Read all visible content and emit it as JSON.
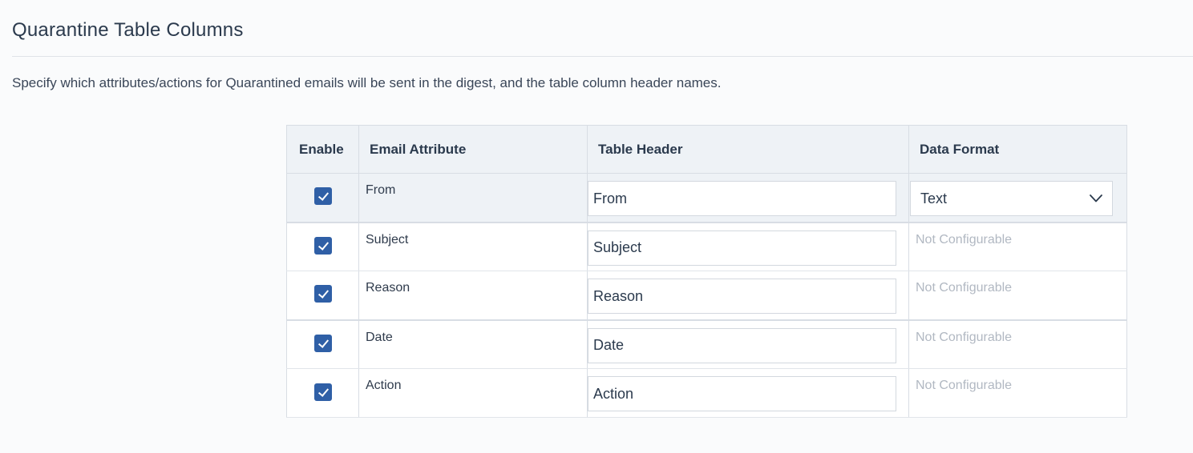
{
  "section": {
    "title": "Quarantine Table Columns",
    "description": "Specify which attributes/actions for Quarantined emails will be sent in the digest, and the table column header names."
  },
  "table": {
    "headers": {
      "enable": "Enable",
      "attribute": "Email Attribute",
      "header": "Table Header",
      "format": "Data Format"
    },
    "rows": [
      {
        "enabled": true,
        "attribute": "From",
        "header": "From",
        "format": "Text",
        "format_configurable": true
      },
      {
        "enabled": true,
        "attribute": "Subject",
        "header": "Subject",
        "format": "Not Configurable",
        "format_configurable": false
      },
      {
        "enabled": true,
        "attribute": "Reason",
        "header": "Reason",
        "format": "Not Configurable",
        "format_configurable": false
      },
      {
        "enabled": true,
        "attribute": "Date",
        "header": "Date",
        "format": "Not Configurable",
        "format_configurable": false
      },
      {
        "enabled": true,
        "attribute": "Action",
        "header": "Action",
        "format": "Not Configurable",
        "format_configurable": false
      }
    ]
  },
  "colors": {
    "checkbox": "#2f5fa6",
    "header_bg": "#eef2f6",
    "muted_text": "#b1b8c2"
  },
  "icons": {
    "checkbox_checked": "check-icon",
    "select_arrow": "chevron-down-icon"
  }
}
